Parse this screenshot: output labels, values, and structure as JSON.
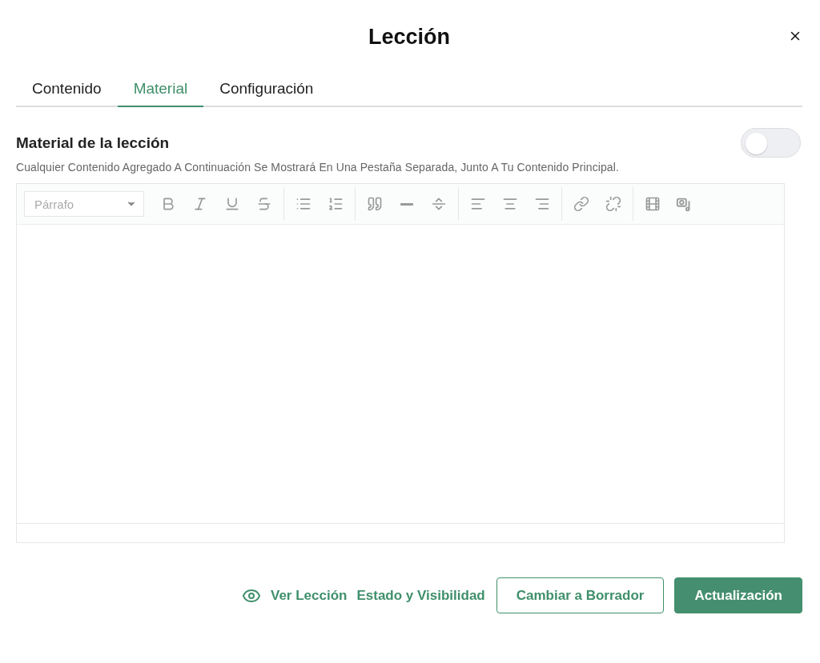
{
  "dialog": {
    "title": "Lección"
  },
  "tabs": [
    {
      "label": "Contenido",
      "selected": false
    },
    {
      "label": "Material",
      "selected": true
    },
    {
      "label": "Configuración",
      "selected": false
    }
  ],
  "section": {
    "title": "Material de la lección",
    "description": "Cualquier Contenido Agregado A Continuación Se Mostrará En Una Pestaña Separada, Junto A Tu Contenido Principal.",
    "toggle_on": false
  },
  "editor": {
    "format_select": {
      "placeholder": "Párrafo"
    },
    "toolbar_groups": [
      [
        {
          "kind": "bold"
        },
        {
          "kind": "italic"
        },
        {
          "kind": "underline"
        },
        {
          "kind": "strikethrough"
        }
      ],
      [
        {
          "kind": "bullets"
        },
        {
          "kind": "numbers"
        }
      ],
      [
        {
          "kind": "quote"
        },
        {
          "kind": "rule"
        },
        {
          "kind": "pagebreak"
        }
      ],
      [
        {
          "kind": "left"
        },
        {
          "kind": "center"
        },
        {
          "kind": "right"
        }
      ],
      [
        {
          "kind": "link"
        },
        {
          "kind": "unlink"
        }
      ],
      [
        {
          "kind": "video"
        },
        {
          "kind": "media"
        }
      ]
    ]
  },
  "footer": {
    "view_link": "Ver Lección",
    "status_link": "Estado y Visibilidad",
    "secondary_button": "Cambiar a Borrador",
    "primary_button": "Actualización"
  }
}
